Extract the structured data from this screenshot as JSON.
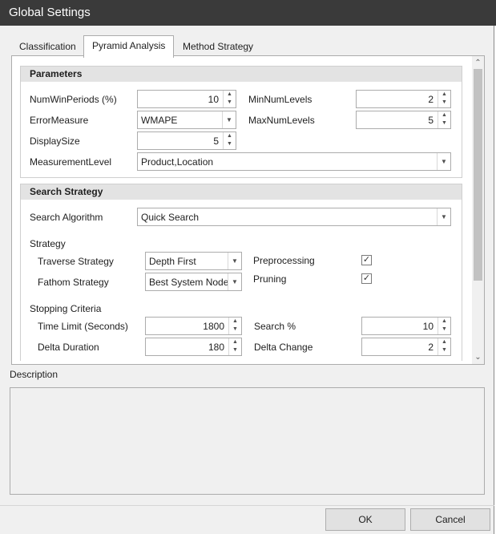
{
  "window": {
    "title": "Global Settings"
  },
  "tabs": [
    {
      "label": "Classification"
    },
    {
      "label": "Pyramid Analysis"
    },
    {
      "label": "Method Strategy"
    }
  ],
  "parameters": {
    "header": "Parameters",
    "num_win_periods": {
      "label": "NumWinPeriods (%)",
      "value": "10"
    },
    "min_num_levels": {
      "label": "MinNumLevels",
      "value": "2"
    },
    "error_measure": {
      "label": "ErrorMeasure",
      "value": "WMAPE"
    },
    "max_num_levels": {
      "label": "MaxNumLevels",
      "value": "5"
    },
    "display_size": {
      "label": "DisplaySize",
      "value": "5"
    },
    "measurement_level": {
      "label": "MeasurementLevel",
      "value": "Product,Location"
    }
  },
  "search_strategy": {
    "header": "Search Strategy",
    "search_algorithm": {
      "label": "Search Algorithm",
      "value": "Quick Search"
    },
    "strategy_label": "Strategy",
    "traverse_strategy": {
      "label": "Traverse Strategy",
      "value": "Depth First"
    },
    "fathom_strategy": {
      "label": "Fathom Strategy",
      "value": "Best System Node"
    },
    "preprocessing": {
      "label": "Preprocessing",
      "checked": true
    },
    "pruning": {
      "label": "Pruning",
      "checked": true
    },
    "stopping_criteria_label": "Stopping Criteria",
    "time_limit": {
      "label": "Time Limit (Seconds)",
      "value": "1800"
    },
    "search_pct": {
      "label": "Search %",
      "value": "10"
    },
    "delta_duration": {
      "label": "Delta Duration",
      "value": "180"
    },
    "delta_change": {
      "label": "Delta Change",
      "value": "2"
    }
  },
  "description": {
    "label": "Description"
  },
  "buttons": {
    "ok": "OK",
    "cancel": "Cancel"
  },
  "icons": {
    "spin_up": "chevron-up-icon",
    "spin_down": "chevron-down-icon",
    "dropdown": "dropdown-arrow-icon",
    "check": "checkmark-icon"
  }
}
